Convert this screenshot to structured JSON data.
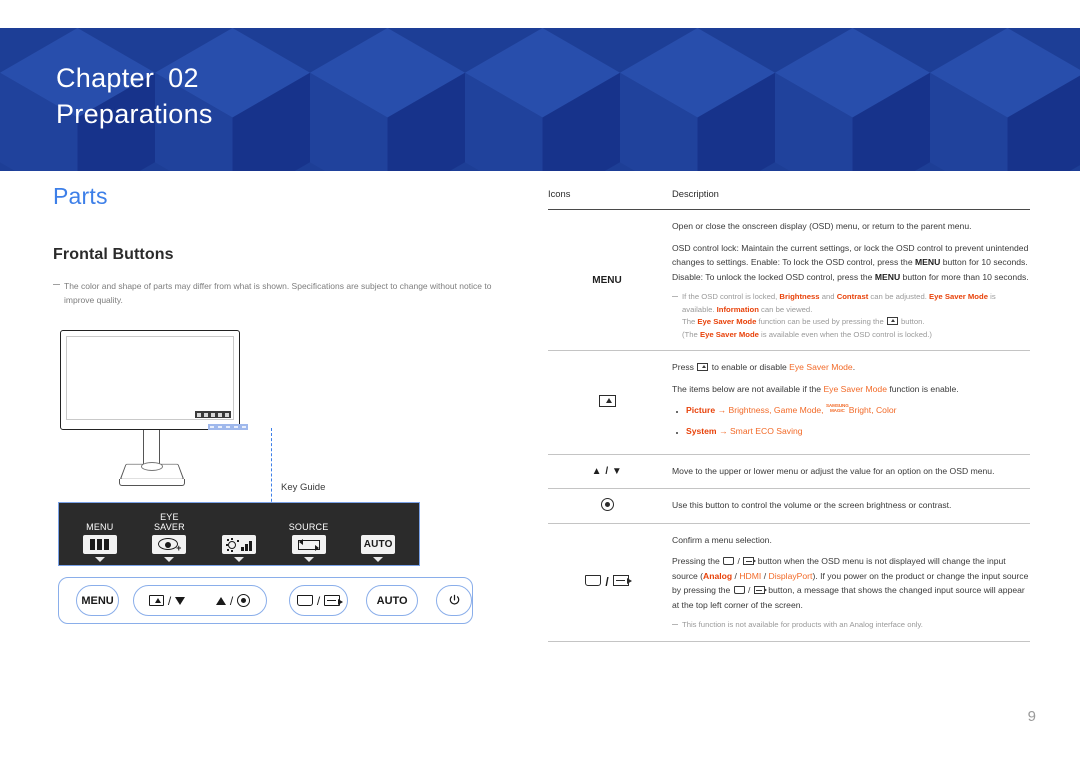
{
  "header": {
    "chapter_label": "Chapter",
    "chapter_number": "02",
    "chapter_title": "Preparations",
    "background_color": "#1d3e97"
  },
  "left": {
    "page_title": "Parts",
    "page_title_color": "#3d7fe8",
    "section_title": "Frontal Buttons",
    "note": "The color and shape of parts may differ from what is shown. Specifications are subject to change without notice to improve quality.",
    "key_guide_label": "Key Guide"
  },
  "key_guide_bar": {
    "items": [
      {
        "label": "MENU",
        "icon": "menu-bars-icon"
      },
      {
        "label": "EYE\nSAVER",
        "icon": "eye-saver-icon"
      },
      {
        "label": "",
        "icon": "brightness-volume-icon"
      },
      {
        "label": "SOURCE",
        "icon": "source-icon"
      },
      {
        "label": "",
        "icon": "auto-icon",
        "icon_text": "AUTO"
      }
    ]
  },
  "buttons_row": {
    "menu": "MENU",
    "auto": "AUTO",
    "power_icon": "power-icon",
    "nav_left_icon": "enter-icon",
    "nav_left_sep": "/",
    "nav_down_icon": "triangle-down-icon",
    "nav_up_icon": "triangle-up-icon",
    "nav_right_sep": "/",
    "nav_right_icon": "dot-icon",
    "source_left_icon": "display-icon",
    "source_sep": "/",
    "source_right_icon": "source-icon"
  },
  "table": {
    "headers": [
      "Icons",
      "Description"
    ],
    "rows": [
      {
        "icon_label": "MENU",
        "icon_type": "text",
        "paragraphs": [
          "Open or close the onscreen display (OSD) menu, or return to the parent menu.",
          "OSD control lock: Maintain the current settings, or lock the OSD control to prevent unintended changes to settings. Enable: To lock the OSD control, press the MENU button for 10 seconds. Disable: To unlock the locked OSD control, press the MENU button for more than 10 seconds."
        ],
        "note_lines": [
          "If the OSD control is locked, Brightness and Contrast can be adjusted. Eye Saver Mode is available. Information can be viewed.",
          "The Eye Saver Mode function can be used by pressing the  button.",
          "(The Eye Saver Mode is available even when the OSD control is locked.)"
        ]
      },
      {
        "icon_label": "enter-icon",
        "icon_type": "icon",
        "paragraphs": [
          "Press  to enable or disable Eye Saver Mode.",
          "The items below are not available if the Eye Saver Mode function is enable."
        ],
        "bullets": [
          "Picture → Brightness, Game Mode, SAMSUNG MAGIC Bright, Color",
          "System → Smart ECO Saving"
        ]
      },
      {
        "icon_label": "▲ / ▼",
        "icon_type": "text",
        "paragraphs": [
          "Move to the upper or lower menu or adjust the value for an option on the OSD menu."
        ]
      },
      {
        "icon_label": "dot-icon",
        "icon_type": "icon",
        "paragraphs": [
          "Use this button to control the volume or the screen brightness or contrast."
        ]
      },
      {
        "icon_label": "display-source-icon",
        "icon_type": "icon",
        "paragraphs": [
          "Confirm a menu selection.",
          "Pressing the  /  button when the OSD menu is not displayed will change the input source (Analog / HDMI / DisplayPort). If you power on the product or change the input source by pressing the  /  button, a message that shows the changed input source will appear at the top left corner of the screen."
        ],
        "note_lines": [
          "This function is not available for products with an Analog interface only."
        ]
      }
    ],
    "highlight_color": "#e8420a",
    "highlight_color_secondary": "#f26a28"
  },
  "footer": {
    "page_number": "9"
  },
  "text_fragments": {
    "t_open_close": "Open or close the onscreen display (OSD) menu, or return to the parent menu.",
    "t_lock_1": "OSD control lock: Maintain the current settings, or lock the OSD control to prevent unintended changes to settings. Enable: To lock the OSD control, press the ",
    "t_lock_menu1": "MENU",
    "t_lock_2": " button for 10 seconds. Disable: To unlock the locked OSD control, press the ",
    "t_lock_menu2": "MENU",
    "t_lock_3": " button for more than 10 seconds.",
    "n1_a": "If the OSD control is locked, ",
    "n1_brightness": "Brightness",
    "n1_b": " and ",
    "n1_contrast": "Contrast",
    "n1_c": " can be adjusted. ",
    "n1_eyesaver": "Eye Saver Mode",
    "n1_d": " is available. ",
    "n1_information": "Information",
    "n1_e": " can be viewed.",
    "n2_a": "The ",
    "n2_eyesaver": "Eye Saver Mode",
    "n2_b": " function can be used by pressing the ",
    "n2_c": " button.",
    "n3_a": "(The ",
    "n3_eyesaver": "Eye Saver Mode",
    "n3_b": " is available even when the OSD control is locked.)",
    "r2_p1_a": "Press ",
    "r2_p1_b": " to enable or disable ",
    "r2_p1_eyesaver": "Eye Saver Mode",
    "r2_p1_c": ".",
    "r2_p2_a": "The items below are not available if the ",
    "r2_p2_eyesaver": "Eye Saver Mode",
    "r2_p2_b": " function is enable.",
    "r2_b1_picture": "Picture",
    "r2_b1_arrow": " → ",
    "r2_b1_rest": "Brightness, Game Mode, ",
    "r2_b1_magic_top": "SAMSUNG",
    "r2_b1_magic_bottom": "MAGIC",
    "r2_b1_bright": "Bright, Color",
    "r2_b2_system": "System",
    "r2_b2_arrow": " → ",
    "r2_b2_rest": "Smart ECO Saving",
    "r3_desc": "Move to the upper or lower menu or adjust the value for an option on the OSD menu.",
    "r3_icon": "▲ / ▼",
    "r4_desc": "Use this button to control the volume or the screen brightness or contrast.",
    "r5_p1": "Confirm a menu selection.",
    "r5_p2_a": "Pressing the ",
    "r5_p2_sep1": " / ",
    "r5_p2_b": " button when the OSD menu is not displayed will change the input source (",
    "r5_analog": "Analog",
    "r5_sep_a": " / ",
    "r5_hdmi": "HDMI",
    "r5_sep_b": " / ",
    "r5_displayport": "DisplayPort",
    "r5_p2_c": "). If you power on the product or change the input source by pressing the ",
    "r5_p2_sep2": " / ",
    "r5_p2_d": " button, a message that shows the changed input source will appear at the top left corner of the screen.",
    "r5_note": "This function is not available for products with an Analog interface only.",
    "sep_slash": "/"
  }
}
